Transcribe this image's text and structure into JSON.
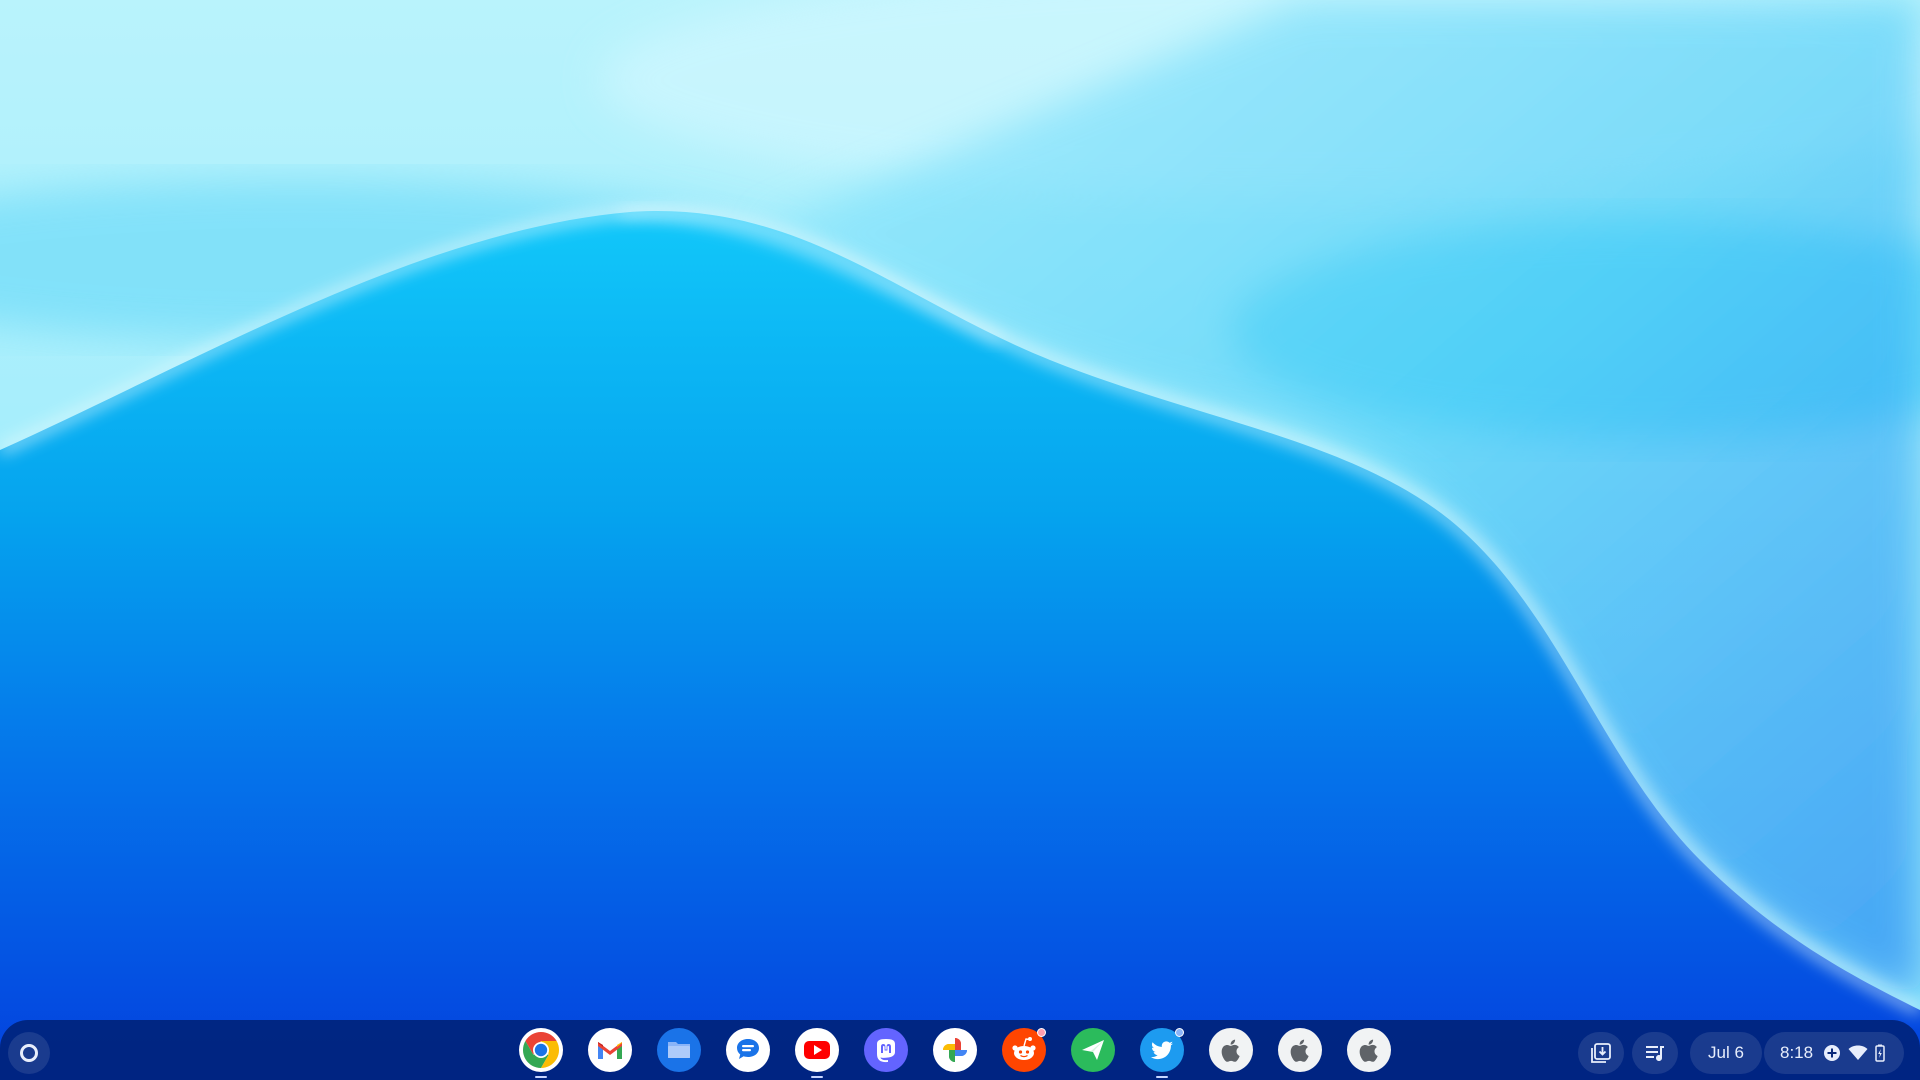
{
  "wallpaper": {
    "colors": {
      "top": "#aef0fb",
      "mid": "#06a6ee",
      "bottom": "#0340de",
      "highlight": "#e6fbff"
    }
  },
  "shelf": {
    "background": "#001e6e",
    "launcher": {
      "icon": "launcher-circle-icon"
    },
    "apps": [
      {
        "name": "chrome",
        "icon": "chrome-icon",
        "running": true,
        "notification": false
      },
      {
        "name": "gmail",
        "icon": "gmail-icon",
        "running": false,
        "notification": false
      },
      {
        "name": "files",
        "icon": "files-icon",
        "running": false,
        "notification": false
      },
      {
        "name": "messages",
        "icon": "messages-icon",
        "running": false,
        "notification": false
      },
      {
        "name": "youtube",
        "icon": "youtube-icon",
        "running": true,
        "notification": false
      },
      {
        "name": "mastodon",
        "icon": "mastodon-icon",
        "running": false,
        "notification": false
      },
      {
        "name": "photos",
        "icon": "photos-icon",
        "running": false,
        "notification": false
      },
      {
        "name": "reddit",
        "icon": "reddit-icon",
        "running": false,
        "notification": true
      },
      {
        "name": "send",
        "icon": "send-icon",
        "running": false,
        "notification": false
      },
      {
        "name": "twitter",
        "icon": "twitter-icon",
        "running": true,
        "notification": true
      },
      {
        "name": "apple-1",
        "icon": "apple-icon",
        "running": false,
        "notification": false
      },
      {
        "name": "apple-2",
        "icon": "apple-icon",
        "running": false,
        "notification": false
      },
      {
        "name": "apple-3",
        "icon": "apple-icon",
        "running": false,
        "notification": false
      }
    ]
  },
  "tray": {
    "holding_space_icon": "holding-space-icon",
    "media_controls_icon": "media-playlist-icon",
    "date": "Jul 6",
    "time": "8:18",
    "status_icons": [
      "add-circle-icon",
      "wifi-icon",
      "battery-icon"
    ]
  }
}
